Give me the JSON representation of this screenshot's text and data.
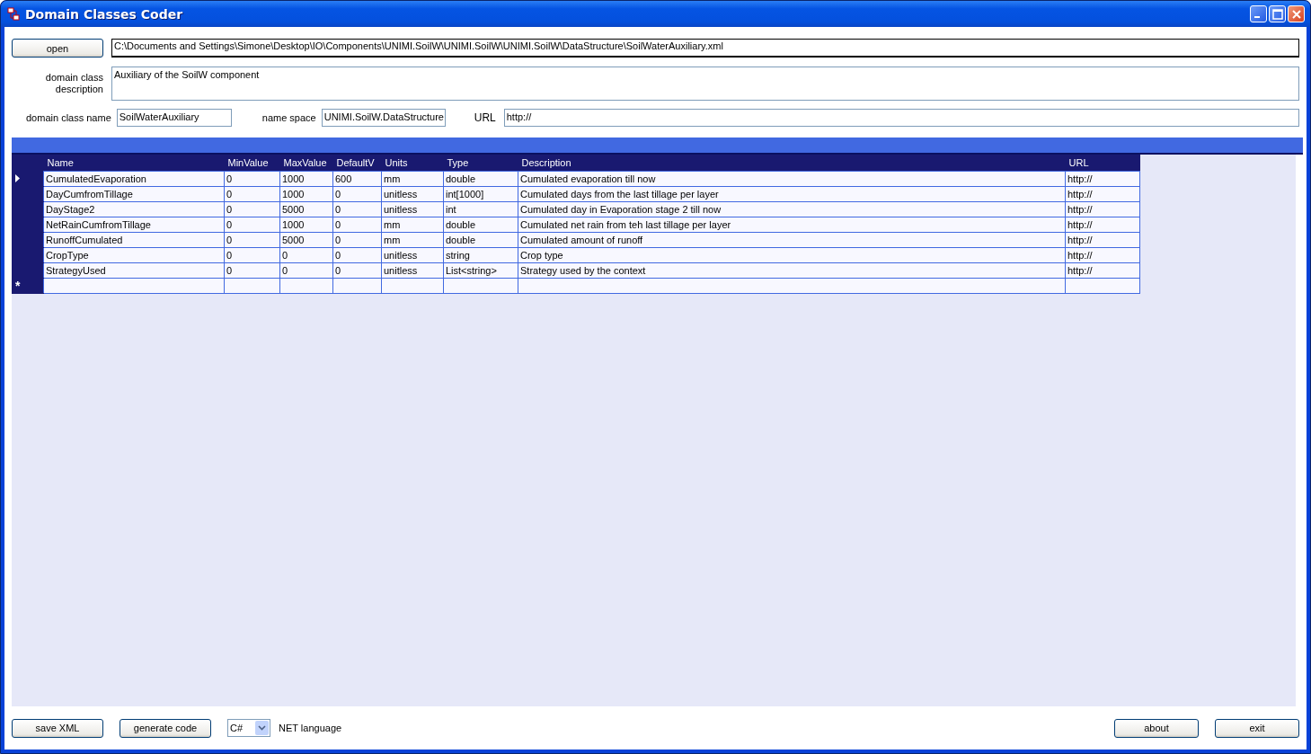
{
  "window": {
    "title": "Domain Classes Coder"
  },
  "file": {
    "button": "open",
    "path": "C:\\Documents and Settings\\Simone\\Desktop\\IO\\Components\\UNIMI.SoilW\\UNIMI.SoilW\\UNIMI.SoilW\\DataStructure\\SoilWaterAuxiliary.xml"
  },
  "description": {
    "label": "domain class description",
    "value": "Auxiliary of the SoilW component"
  },
  "class_name": {
    "label": "domain class name",
    "value": "SoilWaterAuxiliary"
  },
  "name_space": {
    "label": "name space",
    "value": "UNIMI.SoilW.DataStructure"
  },
  "url": {
    "label": "URL",
    "value": "http://"
  },
  "table": {
    "columns": [
      "Name",
      "MinValue",
      "MaxValue",
      "DefaultV",
      "Units",
      "Type",
      "Description",
      "URL"
    ],
    "rows": [
      {
        "selected": true,
        "cells": [
          "CumulatedEvaporation",
          "0",
          "1000",
          "600",
          "mm",
          "double",
          "Cumulated evaporation till now",
          "http://"
        ]
      },
      {
        "selected": false,
        "cells": [
          "DayCumfromTillage",
          "0",
          "1000",
          "0",
          "unitless",
          "int[1000]",
          "Cumulated days from the last tillage per layer",
          "http://"
        ]
      },
      {
        "selected": false,
        "cells": [
          "DayStage2",
          "0",
          "5000",
          "0",
          "unitless",
          "int",
          "Cumulated day in Evaporation stage 2 till now",
          "http://"
        ]
      },
      {
        "selected": false,
        "cells": [
          "NetRainCumfromTillage",
          "0",
          "1000",
          "0",
          "mm",
          "double",
          "Cumulated net rain from teh last tillage per layer",
          "http://"
        ]
      },
      {
        "selected": false,
        "cells": [
          "RunoffCumulated",
          "0",
          "5000",
          "0",
          "mm",
          "double",
          "Cumulated amount of runoff",
          "http://"
        ]
      },
      {
        "selected": false,
        "cells": [
          "CropType",
          "0",
          "0",
          "0",
          "unitless",
          "string",
          "Crop type",
          "http://"
        ]
      },
      {
        "selected": false,
        "cells": [
          "StrategyUsed",
          "0",
          "0",
          "0",
          "unitless",
          "List<string>",
          "Strategy used by the context",
          "http://"
        ]
      }
    ],
    "new_row_marker": "*"
  },
  "footer": {
    "save_button": "save XML",
    "generate_button": "generate code",
    "language": {
      "value": "C#",
      "label": "NET language"
    },
    "about_button": "about",
    "exit_button": "exit"
  }
}
